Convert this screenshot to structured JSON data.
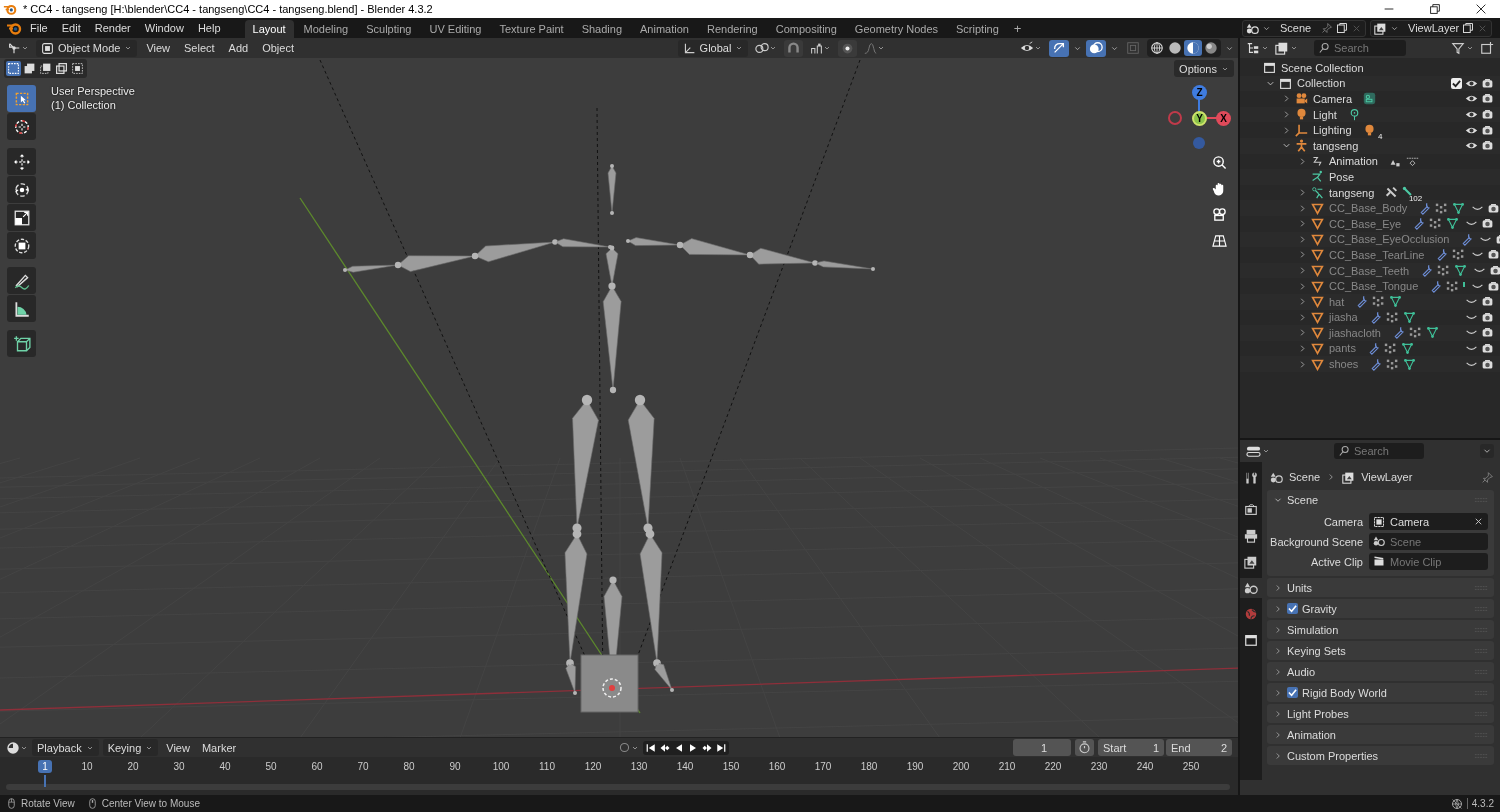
{
  "window": {
    "title": "* CC4 - tangseng [H:\\blender\\CC4 - tangseng\\CC4 - tangseng.blend] - Blender 4.3.2"
  },
  "menus": [
    "File",
    "Edit",
    "Render",
    "Window",
    "Help"
  ],
  "workspaces": [
    {
      "label": "Layout",
      "selected": true
    },
    {
      "label": "Modeling",
      "selected": false
    },
    {
      "label": "Sculpting",
      "selected": false
    },
    {
      "label": "UV Editing",
      "selected": false
    },
    {
      "label": "Texture Paint",
      "selected": false
    },
    {
      "label": "Shading",
      "selected": false
    },
    {
      "label": "Animation",
      "selected": false
    },
    {
      "label": "Rendering",
      "selected": false
    },
    {
      "label": "Compositing",
      "selected": false
    },
    {
      "label": "Geometry Nodes",
      "selected": false
    },
    {
      "label": "Scripting",
      "selected": false
    }
  ],
  "add_workspace": "+",
  "scene": {
    "value": "Scene"
  },
  "view_layer": {
    "value": "ViewLayer"
  },
  "viewport": {
    "mode": "Object Mode",
    "menus": [
      "View",
      "Select",
      "Add",
      "Object"
    ],
    "orientation": "Global",
    "options": "Options",
    "info": [
      "User Perspective",
      "(1) Collection"
    ],
    "select_modes": [
      {
        "selected": true
      },
      {
        "selected": false
      },
      {
        "selected": false
      },
      {
        "selected": false
      },
      {
        "selected": false
      }
    ],
    "tools": [
      {
        "kind": "select",
        "selected": true
      },
      {
        "kind": "cursor",
        "selected": false
      },
      {
        "kind": "move",
        "selected": false
      },
      {
        "kind": "rotate",
        "selected": false
      },
      {
        "kind": "scale",
        "selected": false
      },
      {
        "kind": "transform",
        "selected": false
      },
      {
        "kind": "annotate",
        "selected": false
      },
      {
        "kind": "measure",
        "selected": false
      },
      {
        "kind": "add_cube",
        "selected": false
      }
    ],
    "gizmos": {
      "on": true
    },
    "overlays": {
      "on": true
    },
    "xray": {
      "on": false
    },
    "shading": [
      {
        "kind": "wireframe",
        "selected": false
      },
      {
        "kind": "solid",
        "selected": false
      },
      {
        "kind": "material",
        "selected": true
      },
      {
        "kind": "rendered",
        "selected": false
      }
    ],
    "axes": [
      "Z",
      "Y",
      "X"
    ]
  },
  "timeline": {
    "menus": [
      "Playback",
      "Keying",
      "View",
      "Marker"
    ],
    "current_frame": "1",
    "start_label": "Start",
    "start": "1",
    "end_label": "End",
    "end": "2",
    "ruler": [
      {
        "label": "1",
        "selected": true
      },
      {
        "label": "10",
        "selected": false
      },
      {
        "label": "20",
        "selected": false
      },
      {
        "label": "30",
        "selected": false
      },
      {
        "label": "40",
        "selected": false
      },
      {
        "label": "50",
        "selected": false
      },
      {
        "label": "60",
        "selected": false
      },
      {
        "label": "70",
        "selected": false
      },
      {
        "label": "80",
        "selected": false
      },
      {
        "label": "90",
        "selected": false
      },
      {
        "label": "100",
        "selected": false
      },
      {
        "label": "110",
        "selected": false
      },
      {
        "label": "120",
        "selected": false
      },
      {
        "label": "130",
        "selected": false
      },
      {
        "label": "140",
        "selected": false
      },
      {
        "label": "150",
        "selected": false
      },
      {
        "label": "160",
        "selected": false
      },
      {
        "label": "170",
        "selected": false
      },
      {
        "label": "180",
        "selected": false
      },
      {
        "label": "190",
        "selected": false
      },
      {
        "label": "200",
        "selected": false
      },
      {
        "label": "210",
        "selected": false
      },
      {
        "label": "220",
        "selected": false
      },
      {
        "label": "230",
        "selected": false
      },
      {
        "label": "240",
        "selected": false
      },
      {
        "label": "250",
        "selected": false
      }
    ]
  },
  "outliner": {
    "search_placeholder": "Search",
    "tree": [
      {
        "name": "Scene Collection",
        "kind": "scene_collection",
        "children": [
          {
            "name": "Collection",
            "kind": "collection",
            "expanded": true,
            "checked": true,
            "visible": true,
            "children": [
              {
                "name": "Camera",
                "kind": "camera",
                "expanded": false,
                "visible": true,
                "extras": [
                  {
                    "kind": "camera_data"
                  }
                ]
              },
              {
                "name": "Light",
                "kind": "light",
                "expanded": false,
                "visible": true,
                "extras": [
                  {
                    "kind": "light_data"
                  }
                ]
              },
              {
                "name": "Lighting",
                "kind": "empty",
                "expanded": false,
                "visible": true,
                "extras": [
                  {
                    "kind": "light"
                  }
                ],
                "count": "4"
              },
              {
                "name": "tangseng",
                "kind": "armature",
                "expanded": true,
                "visible": true,
                "children": [
                  {
                    "name": "Animation",
                    "kind": "animation",
                    "expanded": false,
                    "extras": [
                      {
                        "kind": "action"
                      },
                      {
                        "kind": "driver"
                      }
                    ]
                  },
                  {
                    "name": "Pose",
                    "kind": "pose"
                  },
                  {
                    "name": "tangseng",
                    "kind": "armature_data",
                    "expanded": false,
                    "extras": [
                      {
                        "kind": "bone"
                      },
                      {
                        "kind": "bone_data"
                      }
                    ],
                    "count": "102"
                  },
                  {
                    "name": "CC_Base_Body",
                    "kind": "mesh",
                    "expanded": false,
                    "visible": false,
                    "extras": [
                      {
                        "kind": "modifier"
                      },
                      {
                        "kind": "vertex_groups"
                      },
                      {
                        "kind": "mesh_data"
                      }
                    ]
                  },
                  {
                    "name": "CC_Base_Eye",
                    "kind": "mesh",
                    "expanded": false,
                    "visible": false,
                    "extras": [
                      {
                        "kind": "modifier"
                      },
                      {
                        "kind": "vertex_groups"
                      },
                      {
                        "kind": "mesh_data"
                      }
                    ]
                  },
                  {
                    "name": "CC_Base_EyeOcclusion",
                    "kind": "mesh",
                    "expanded": false,
                    "visible": false,
                    "extras": [
                      {
                        "kind": "modifier"
                      }
                    ]
                  },
                  {
                    "name": "CC_Base_TearLine",
                    "kind": "mesh",
                    "expanded": false,
                    "visible": false,
                    "extras": [
                      {
                        "kind": "modifier"
                      },
                      {
                        "kind": "vertex_groups"
                      }
                    ]
                  },
                  {
                    "name": "CC_Base_Teeth",
                    "kind": "mesh",
                    "expanded": false,
                    "visible": false,
                    "extras": [
                      {
                        "kind": "modifier"
                      },
                      {
                        "kind": "vertex_groups"
                      },
                      {
                        "kind": "mesh_data"
                      }
                    ]
                  },
                  {
                    "name": "CC_Base_Tongue",
                    "kind": "mesh",
                    "expanded": false,
                    "visible": false,
                    "extras": [
                      {
                        "kind": "modifier"
                      },
                      {
                        "kind": "vertex_groups"
                      },
                      {
                        "kind": "tick"
                      }
                    ]
                  },
                  {
                    "name": "hat",
                    "kind": "mesh",
                    "expanded": false,
                    "visible": false,
                    "extras": [
                      {
                        "kind": "modifier"
                      },
                      {
                        "kind": "vertex_groups"
                      },
                      {
                        "kind": "mesh_data"
                      }
                    ]
                  },
                  {
                    "name": "jiasha",
                    "kind": "mesh",
                    "expanded": false,
                    "visible": false,
                    "extras": [
                      {
                        "kind": "modifier"
                      },
                      {
                        "kind": "vertex_groups"
                      },
                      {
                        "kind": "mesh_data"
                      }
                    ]
                  },
                  {
                    "name": "jiashacloth",
                    "kind": "mesh",
                    "expanded": false,
                    "visible": false,
                    "extras": [
                      {
                        "kind": "modifier"
                      },
                      {
                        "kind": "vertex_groups"
                      },
                      {
                        "kind": "mesh_data"
                      }
                    ]
                  },
                  {
                    "name": "pants",
                    "kind": "mesh",
                    "expanded": false,
                    "visible": false,
                    "extras": [
                      {
                        "kind": "modifier"
                      },
                      {
                        "kind": "vertex_groups"
                      },
                      {
                        "kind": "mesh_data"
                      }
                    ]
                  },
                  {
                    "name": "shoes",
                    "kind": "mesh",
                    "expanded": false,
                    "visible": false,
                    "extras": [
                      {
                        "kind": "modifier"
                      },
                      {
                        "kind": "vertex_groups"
                      },
                      {
                        "kind": "mesh_data"
                      }
                    ]
                  }
                ]
              }
            ]
          }
        ]
      }
    ]
  },
  "properties": {
    "search_placeholder": "Search",
    "tabs": [
      {
        "kind": "tool",
        "selected": false
      },
      {
        "kind": "render",
        "selected": false
      },
      {
        "kind": "output",
        "selected": false
      },
      {
        "kind": "view_layer",
        "selected": false
      },
      {
        "kind": "scene",
        "selected": true
      },
      {
        "kind": "world",
        "selected": false
      },
      {
        "kind": "collection",
        "selected": false
      }
    ],
    "breadcrumb": [
      "Scene",
      "ViewLayer"
    ],
    "panels": [
      {
        "title": "Scene",
        "expanded": true,
        "fields": [
          {
            "label": "Camera",
            "value": "Camera",
            "kind": "object"
          },
          {
            "label": "Background Scene",
            "placeholder": "Scene",
            "kind": "scene"
          },
          {
            "label": "Active Clip",
            "placeholder": "Movie Clip",
            "kind": "clip"
          }
        ]
      },
      {
        "title": "Units",
        "expanded": false
      },
      {
        "title": "Gravity",
        "expanded": false,
        "checked": true
      },
      {
        "title": "Simulation",
        "expanded": false
      },
      {
        "title": "Keying Sets",
        "expanded": false
      },
      {
        "title": "Audio",
        "expanded": false
      },
      {
        "title": "Rigid Body World",
        "expanded": false,
        "checked": true
      },
      {
        "title": "Light Probes",
        "expanded": false
      },
      {
        "title": "Animation",
        "expanded": false
      },
      {
        "title": "Custom Properties",
        "expanded": false
      }
    ]
  },
  "status_bar": {
    "hints": [
      "Rotate View",
      "Center View to Mouse"
    ],
    "version": "4.3.2"
  }
}
